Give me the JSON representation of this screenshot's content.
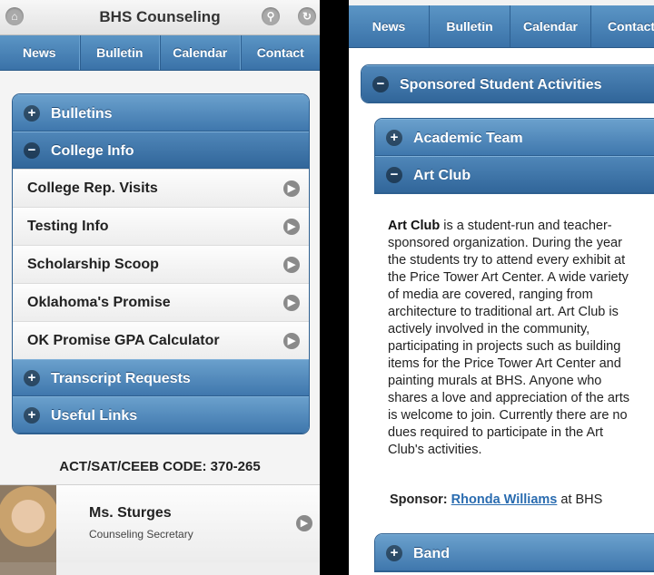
{
  "left": {
    "header": {
      "title": "BHS Counseling",
      "home_icon": "home-icon",
      "search_icon": "search-icon",
      "back_icon": "back-icon"
    },
    "nav": [
      "News",
      "Bulletin",
      "Calendar",
      "Contact"
    ],
    "sections": {
      "bulletins": "Bulletins",
      "college_info": "College Info",
      "college_items": [
        "College Rep. Visits",
        "Testing Info",
        "Scholarship Scoop",
        "Oklahoma's Promise",
        "OK Promise GPA Calculator"
      ],
      "transcript": "Transcript Requests",
      "useful_links": "Useful Links"
    },
    "ceeb": "ACT/SAT/CEEB CODE: 370-265",
    "contact": {
      "name": "Ms. Sturges",
      "title": "Counseling Secretary"
    }
  },
  "right": {
    "nav": [
      "News",
      "Bulletin",
      "Calendar",
      "Contact"
    ],
    "sponsored": "Sponsored Student Activities",
    "academic_team": "Academic Team",
    "art_club": "Art Club",
    "article_lead": "Art Club",
    "article_body": " is a student-run and teacher-sponsored organization. During the year the students try to attend every exhibit at the Price Tower Art Center. A wide variety of media are covered, ranging from architecture to traditional art. Art Club is actively involved in the community, participating in projects such as building items for the Price Tower Art Center and painting murals at BHS. Anyone who shares a love and appreciation of the arts is welcome to join. Currently there are no dues required to participate in the Art Club's activities.",
    "sponsor_label": "Sponsor:",
    "sponsor_name": "Rhonda Williams",
    "sponsor_suffix": " at BHS",
    "band": "Band"
  },
  "colors": {
    "accent": "#3f77ad",
    "link": "#2a6cb0"
  }
}
